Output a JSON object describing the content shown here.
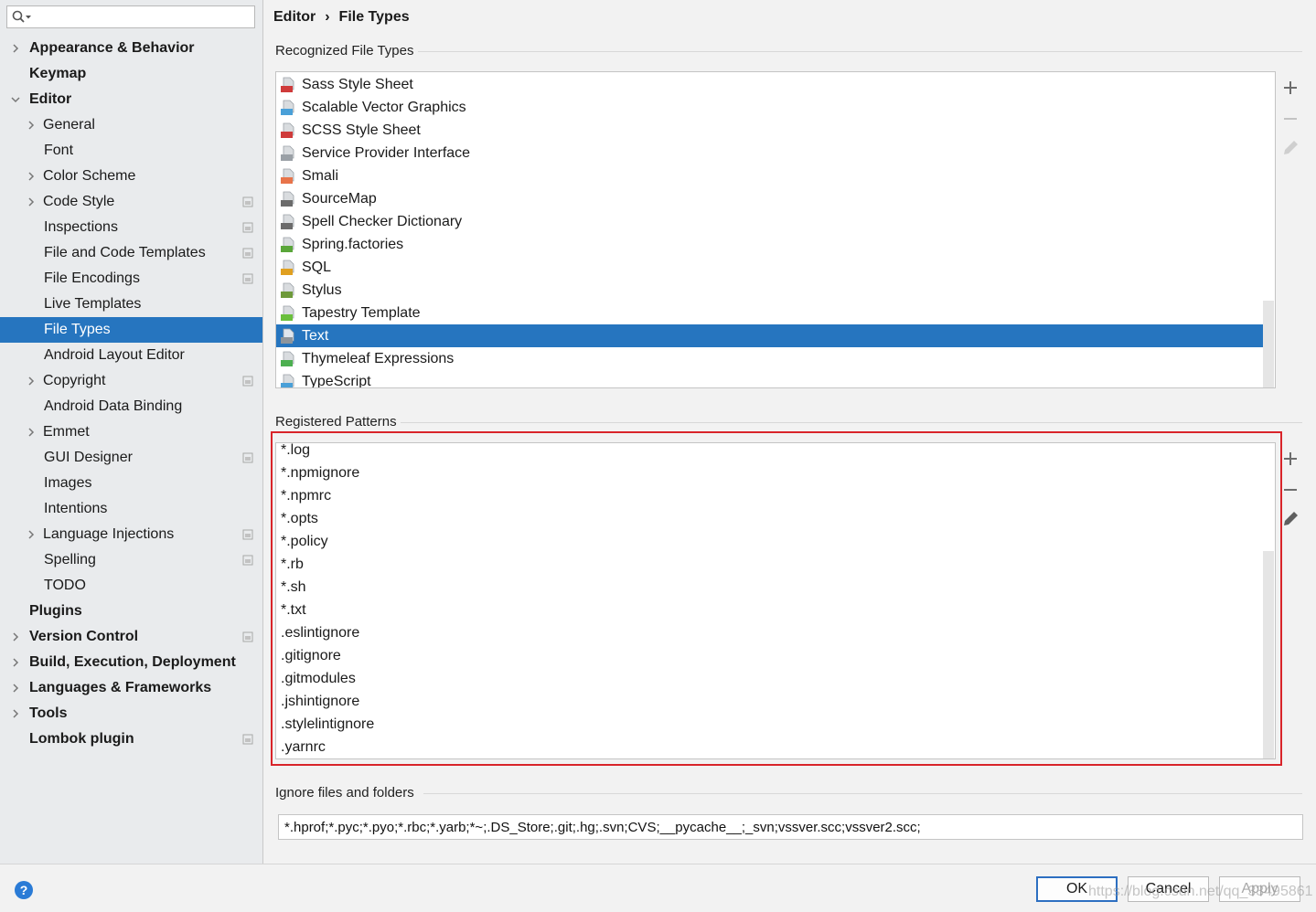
{
  "search": {
    "value": ""
  },
  "tree": [
    {
      "label": "Appearance & Behavior",
      "level": 0,
      "expand": "collapsed",
      "project": false
    },
    {
      "label": "Keymap",
      "level": 0,
      "expand": "none",
      "project": false
    },
    {
      "label": "Editor",
      "level": 0,
      "expand": "expanded",
      "project": false
    },
    {
      "label": "General",
      "level": 1,
      "expand": "collapsed",
      "project": false
    },
    {
      "label": "Font",
      "level": 1,
      "expand": "none",
      "project": false
    },
    {
      "label": "Color Scheme",
      "level": 1,
      "expand": "collapsed",
      "project": false
    },
    {
      "label": "Code Style",
      "level": 1,
      "expand": "collapsed",
      "project": true
    },
    {
      "label": "Inspections",
      "level": 1,
      "expand": "none",
      "project": true
    },
    {
      "label": "File and Code Templates",
      "level": 1,
      "expand": "none",
      "project": true
    },
    {
      "label": "File Encodings",
      "level": 1,
      "expand": "none",
      "project": true
    },
    {
      "label": "Live Templates",
      "level": 1,
      "expand": "none",
      "project": false
    },
    {
      "label": "File Types",
      "level": 1,
      "expand": "none",
      "project": false,
      "selected": true
    },
    {
      "label": "Android Layout Editor",
      "level": 1,
      "expand": "none",
      "project": false
    },
    {
      "label": "Copyright",
      "level": 1,
      "expand": "collapsed",
      "project": true
    },
    {
      "label": "Android Data Binding",
      "level": 1,
      "expand": "none",
      "project": false
    },
    {
      "label": "Emmet",
      "level": 1,
      "expand": "collapsed",
      "project": false
    },
    {
      "label": "GUI Designer",
      "level": 1,
      "expand": "none",
      "project": true
    },
    {
      "label": "Images",
      "level": 1,
      "expand": "none",
      "project": false
    },
    {
      "label": "Intentions",
      "level": 1,
      "expand": "none",
      "project": false
    },
    {
      "label": "Language Injections",
      "level": 1,
      "expand": "collapsed",
      "project": true
    },
    {
      "label": "Spelling",
      "level": 1,
      "expand": "none",
      "project": true
    },
    {
      "label": "TODO",
      "level": 1,
      "expand": "none",
      "project": false
    },
    {
      "label": "Plugins",
      "level": 0,
      "expand": "none",
      "project": false
    },
    {
      "label": "Version Control",
      "level": 0,
      "expand": "collapsed",
      "project": true
    },
    {
      "label": "Build, Execution, Deployment",
      "level": 0,
      "expand": "collapsed",
      "project": false
    },
    {
      "label": "Languages & Frameworks",
      "level": 0,
      "expand": "collapsed",
      "project": false
    },
    {
      "label": "Tools",
      "level": 0,
      "expand": "collapsed",
      "project": false
    },
    {
      "label": "Lombok plugin",
      "level": 0,
      "expand": "none",
      "project": true
    }
  ],
  "breadcrumb": {
    "parent": "Editor",
    "separator": "›",
    "current": "File Types"
  },
  "recognized": {
    "title": "Recognized File Types",
    "items": [
      {
        "name": "Sass Style Sheet",
        "icon": "sass",
        "color": "#cf3b3b"
      },
      {
        "name": "Scalable Vector Graphics",
        "icon": "svg",
        "color": "#4aa0d8"
      },
      {
        "name": "SCSS Style Sheet",
        "icon": "sass",
        "color": "#cf3b3b"
      },
      {
        "name": "Service Provider Interface",
        "icon": "file",
        "color": "#9aa0a6"
      },
      {
        "name": "Smali",
        "icon": "smali",
        "color": "#e8744a"
      },
      {
        "name": "SourceMap",
        "icon": "sourcemap",
        "color": "#6b6b6b"
      },
      {
        "name": "Spell Checker Dictionary",
        "icon": "dictionary",
        "color": "#6b6b6b"
      },
      {
        "name": "Spring.factories",
        "icon": "spring",
        "color": "#5aa63a"
      },
      {
        "name": "SQL",
        "icon": "sql",
        "color": "#e0a020"
      },
      {
        "name": "Stylus",
        "icon": "styl",
        "color": "#6e9a3a"
      },
      {
        "name": "Tapestry Template",
        "icon": "tapestry",
        "color": "#6abf3c"
      },
      {
        "name": "Text",
        "icon": "text",
        "color": "#8e959c",
        "selected": true
      },
      {
        "name": "Thymeleaf Expressions",
        "icon": "thymeleaf",
        "color": "#4caf50"
      },
      {
        "name": "TypeScript",
        "icon": "ts",
        "color": "#4aa0d8"
      }
    ]
  },
  "patterns": {
    "title": "Registered Patterns",
    "items": [
      "*.log",
      "*.npmignore",
      "*.npmrc",
      "*.opts",
      "*.policy",
      "*.rb",
      "*.sh",
      "*.txt",
      ".eslintignore",
      ".gitignore",
      ".gitmodules",
      ".jshintignore",
      ".stylelintignore",
      ".yarnrc"
    ]
  },
  "ignore": {
    "title": "Ignore files and folders",
    "value": "*.hprof;*.pyc;*.pyo;*.rbc;*.yarb;*~;.DS_Store;.git;.hg;.svn;CVS;__pycache__;_svn;vssver.scc;vssver2.scc;"
  },
  "footer": {
    "help": "?",
    "ok": "OK",
    "cancel": "Cancel",
    "apply": "Apply",
    "watermark": "https://blog.csdn.net/qq_33495861"
  },
  "colors": {
    "selection": "#2675bf",
    "highlight_border": "#d9242a",
    "accent": "#2a7bd6"
  }
}
